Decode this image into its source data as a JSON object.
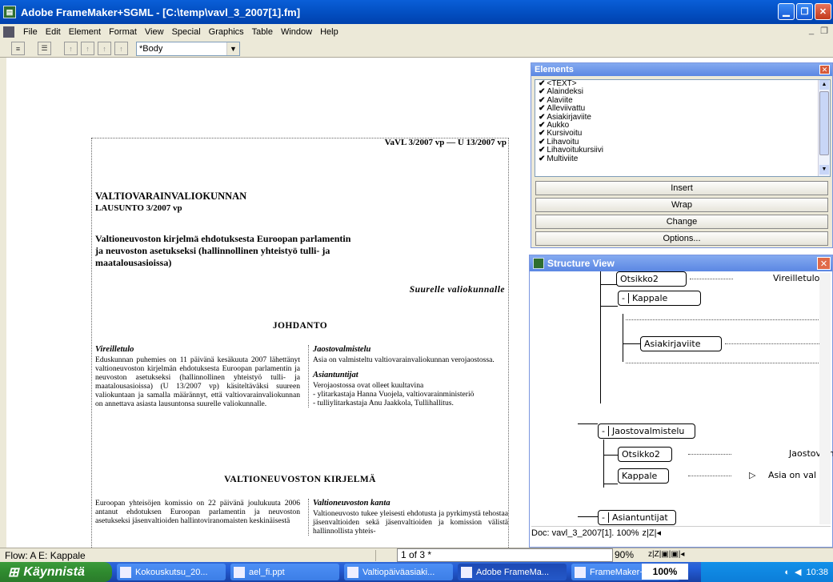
{
  "window": {
    "title": "Adobe FrameMaker+SGML - [C:\\temp\\vavl_3_2007[1].fm]"
  },
  "menu": [
    "File",
    "Edit",
    "Element",
    "Format",
    "View",
    "Special",
    "Graphics",
    "Table",
    "Window",
    "Help"
  ],
  "toolbar": {
    "paragraph_tag": "*Body"
  },
  "document": {
    "running_head": "VaVL 3/2007 vp — U 13/2007 vp",
    "heading_line1": "VALTIOVARAINVALIOKUNNAN",
    "heading_line2": "LAUSUNTO 3/2007 vp",
    "subject": "Valtioneuvoston kirjelmä ehdotuksesta Euroopan parlamentin ja neuvoston asetukseksi (hallinnollinen yhteistyö tulli- ja maatalousasioissa)",
    "recipient": "Suurelle valiokunnalle",
    "section1": "JOHDANTO",
    "vireilletulo_title": "Vireilletulo",
    "vireilletulo_text": "Eduskunnan puhemies on 11 päivänä kesäkuuta 2007 lähettänyt valtioneuvoston kirjelmän ehdotuksesta Euroopan parlamentin ja neuvoston asetukseksi (hallinnollinen yhteistyö tulli- ja maatalousasioissa) (U 13/2007 vp) käsiteltäväksi suureen valiokuntaan ja samalla määrännyt, että valtiovarainvaliokunnan on annettava asiasta lausuntonsa suurelle valiokunnalle.",
    "jaosto_title": "Jaostovalmistelu",
    "jaosto_text": "Asia on valmisteltu valtiovarainvaliokunnan verojaostossa.",
    "asiantuntijat_title": "Asiantuntijat",
    "asiantuntijat_intro": "Verojaostossa ovat olleet kuultavina",
    "expert1": "- ylitarkastaja Hanna Vuojela, valtiovarainministeriö",
    "expert2": "- tulliylitarkastaja Anu Jaakkola, Tullihallitus.",
    "section2": "VALTIONEUVOSTON KIRJELMÄ",
    "bottom_left": "Euroopan yhteisöjen komissio on 22 päivänä joulukuuta 2006 antanut ehdotuksen Euroopan parlamentin ja neuvoston asetukseksi jäsenvaltioiden hallintoviranomaisten keskinäisestä",
    "kanta_title": "Valtioneuvoston kanta",
    "kanta_text": "Valtioneuvosto tukee yleisesti ehdotusta ja pyrkimystä tehostaa jäsenvaltioiden sekä jäsenvaltioiden ja komission välistä hallinnollista yhteis-"
  },
  "elements_panel": {
    "title": "Elements",
    "items": [
      "<TEXT>",
      "Alaindeksi",
      "Alaviite",
      "Alleviivattu",
      "Asiakirjaviite",
      "Aukko",
      "Kursivoitu",
      "Lihavoitu",
      "Lihavoitukursiivi",
      "Multiviite"
    ],
    "buttons": [
      "Insert",
      "Wrap",
      "Change",
      "Options..."
    ]
  },
  "structure_view": {
    "title": "Structure View",
    "nodes": {
      "otsikko2_top": "Otsikko2",
      "kappale_top": "Kappale",
      "asiakirjaviite": "Asiakirjaviite",
      "jaostovalmistelu": "Jaostovalmistelu",
      "otsikko2": "Otsikko2",
      "kappale": "Kappale",
      "asiantuntijat": "Asiantuntijat"
    },
    "labels": {
      "vireilletulo": "Vireilletulo",
      "jaostovalm": "Jaostovalm",
      "asia_on": "Asia on val"
    },
    "status": "Doc: vavl_3_2007[1].  100%"
  },
  "statusbar": {
    "flow": "Flow: A  E: Kappale",
    "page": "1 of 3 *",
    "zoom": "90%"
  },
  "taskbar": {
    "start": "Käynnistä",
    "tasks": [
      "Kokouskutsu_20...",
      "ael_fi.ppt",
      "Valtiopäiväasiaki...",
      "Adobe FrameMa...",
      "FrameMaker+S..."
    ],
    "zoom_pct": "100%",
    "clock": "10:38"
  }
}
